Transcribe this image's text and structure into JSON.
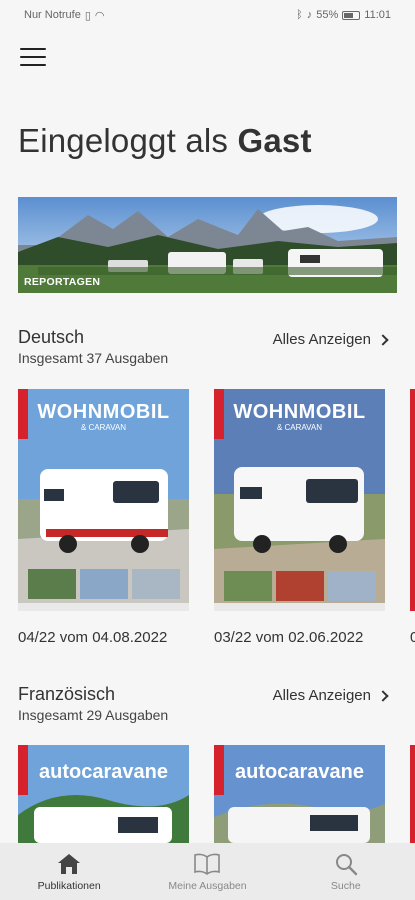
{
  "statusbar": {
    "carrier": "Nur Notrufe",
    "battery": "55%",
    "time": "11:01"
  },
  "header": {
    "headline_prefix": "Eingeloggt als",
    "headline_user": "Gast"
  },
  "banner": {
    "label": "REPORTAGEN"
  },
  "sections": [
    {
      "title": "Deutsch",
      "subtitle": "Insgesamt 37 Ausgaben",
      "see_all": "Alles Anzeigen",
      "issues": [
        {
          "caption": "04/22 vom 04.08.2022",
          "masthead": "WOHNMOBIL",
          "masthead_sub": "& CARAVAN"
        },
        {
          "caption": "03/22 vom 02.06.2022",
          "masthead": "WOHNMOBIL",
          "masthead_sub": "& CARAVAN"
        },
        {
          "caption": "0"
        }
      ]
    },
    {
      "title": "Französisch",
      "subtitle": "Insgesamt 29 Ausgaben",
      "see_all": "Alles Anzeigen",
      "issues": [
        {
          "masthead": "autocaravane"
        },
        {
          "masthead": "autocaravane"
        }
      ]
    }
  ],
  "bottom_nav": {
    "items": [
      {
        "label": "Publikationen",
        "icon": "home-icon",
        "active": true
      },
      {
        "label": "Meine Ausgaben",
        "icon": "book-icon",
        "active": false
      },
      {
        "label": "Suche",
        "icon": "search-icon",
        "active": false
      }
    ]
  },
  "colors": {
    "background": "#f6f6f6",
    "nav_background": "#ebebeb",
    "text": "#333333",
    "swiss_red": "#d5222c"
  }
}
